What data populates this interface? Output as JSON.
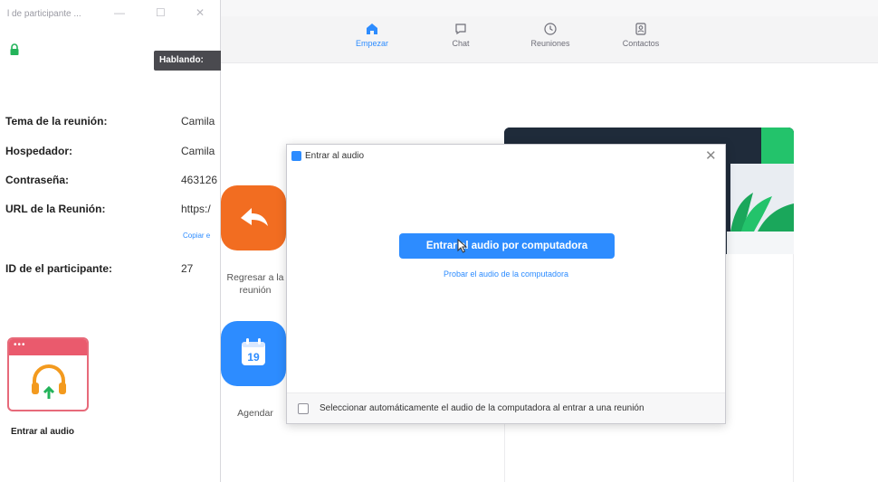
{
  "main_window": {
    "nav": {
      "tabs": [
        {
          "label": "Empezar",
          "icon": "home-icon",
          "active": true
        },
        {
          "label": "Chat",
          "icon": "chat-icon",
          "active": false
        },
        {
          "label": "Reuniones",
          "icon": "clock-icon",
          "active": false
        },
        {
          "label": "Contactos",
          "icon": "contacts-icon",
          "active": false
        }
      ]
    },
    "actions": {
      "return_label": "Regresar a la reunión",
      "schedule_label": "Agendar",
      "calendar_day": "19"
    }
  },
  "participant_window": {
    "title": "l de participante ...",
    "speaking_label": "Hablando:",
    "info": [
      {
        "label": "Tema de la reunión:",
        "value": "Camila"
      },
      {
        "label": "Hospedador:",
        "value": "Camila"
      },
      {
        "label": "Contraseña:",
        "value": "463126"
      },
      {
        "label": "URL de la Reunión:",
        "value": "https:/"
      },
      {
        "label": "ID de el participante:",
        "value": "27"
      }
    ],
    "copy_link": "Copiar e",
    "join_audio_label": "Entrar al audio"
  },
  "audio_dialog": {
    "title": "Entrar al audio",
    "primary_button": "Entrar al audio por computadora",
    "test_link": "Probar el audio de la computadora",
    "auto_checkbox_label": "Seleccionar automáticamente el audio de la computadora al entrar a una reunión",
    "auto_checkbox_checked": false
  },
  "colors": {
    "accent": "#2d8cff",
    "orange": "#f26d21",
    "speaking_badge": "#4a4a4f",
    "tile_red": "#ea5a6d",
    "hero_dark": "#1f2b3a"
  }
}
